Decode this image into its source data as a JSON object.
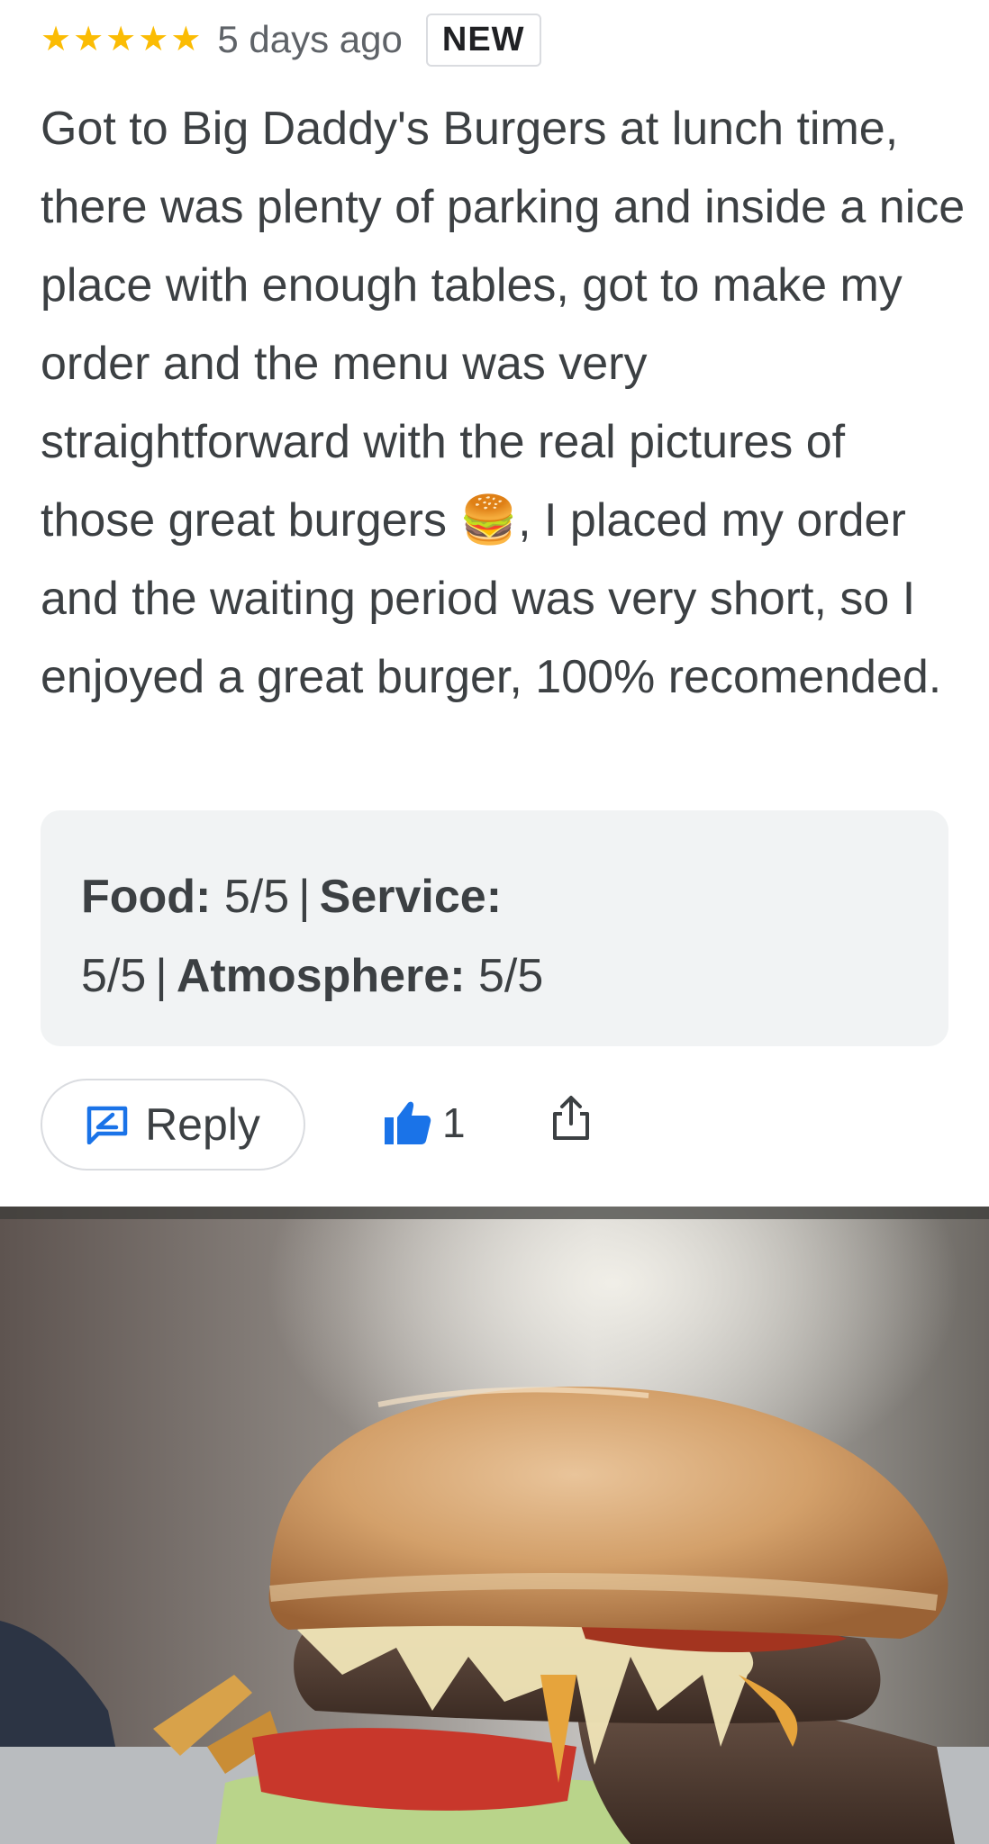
{
  "review": {
    "rating": 5,
    "stars": [
      "★",
      "★",
      "★",
      "★",
      "★"
    ],
    "time": "5 days ago",
    "badge": "NEW",
    "text": "Got to Big Daddy's Burgers at lunch time, there was plenty of parking and inside a nice place with enough tables, got to make my order and the menu was very straightforward with the real pictures of those great burgers 🍔, I placed my order and the waiting period was very short, so I enjoyed a great burger, 100% recomended."
  },
  "ratings": {
    "food_label": "Food:",
    "food_value": "5/5",
    "service_label": "Service:",
    "service_value": "5/5",
    "atmosphere_label": "Atmosphere:",
    "atmosphere_value": "5/5",
    "separator": "|"
  },
  "actions": {
    "reply_label": "Reply",
    "like_count": "1"
  },
  "icons": {
    "star": "star-icon",
    "reply": "reply-icon",
    "like": "thumbs-up-icon",
    "share": "share-icon"
  },
  "colors": {
    "star": "#fbbc04",
    "accent": "#1a73e8",
    "ratings_bg": "#f1f3f4"
  }
}
